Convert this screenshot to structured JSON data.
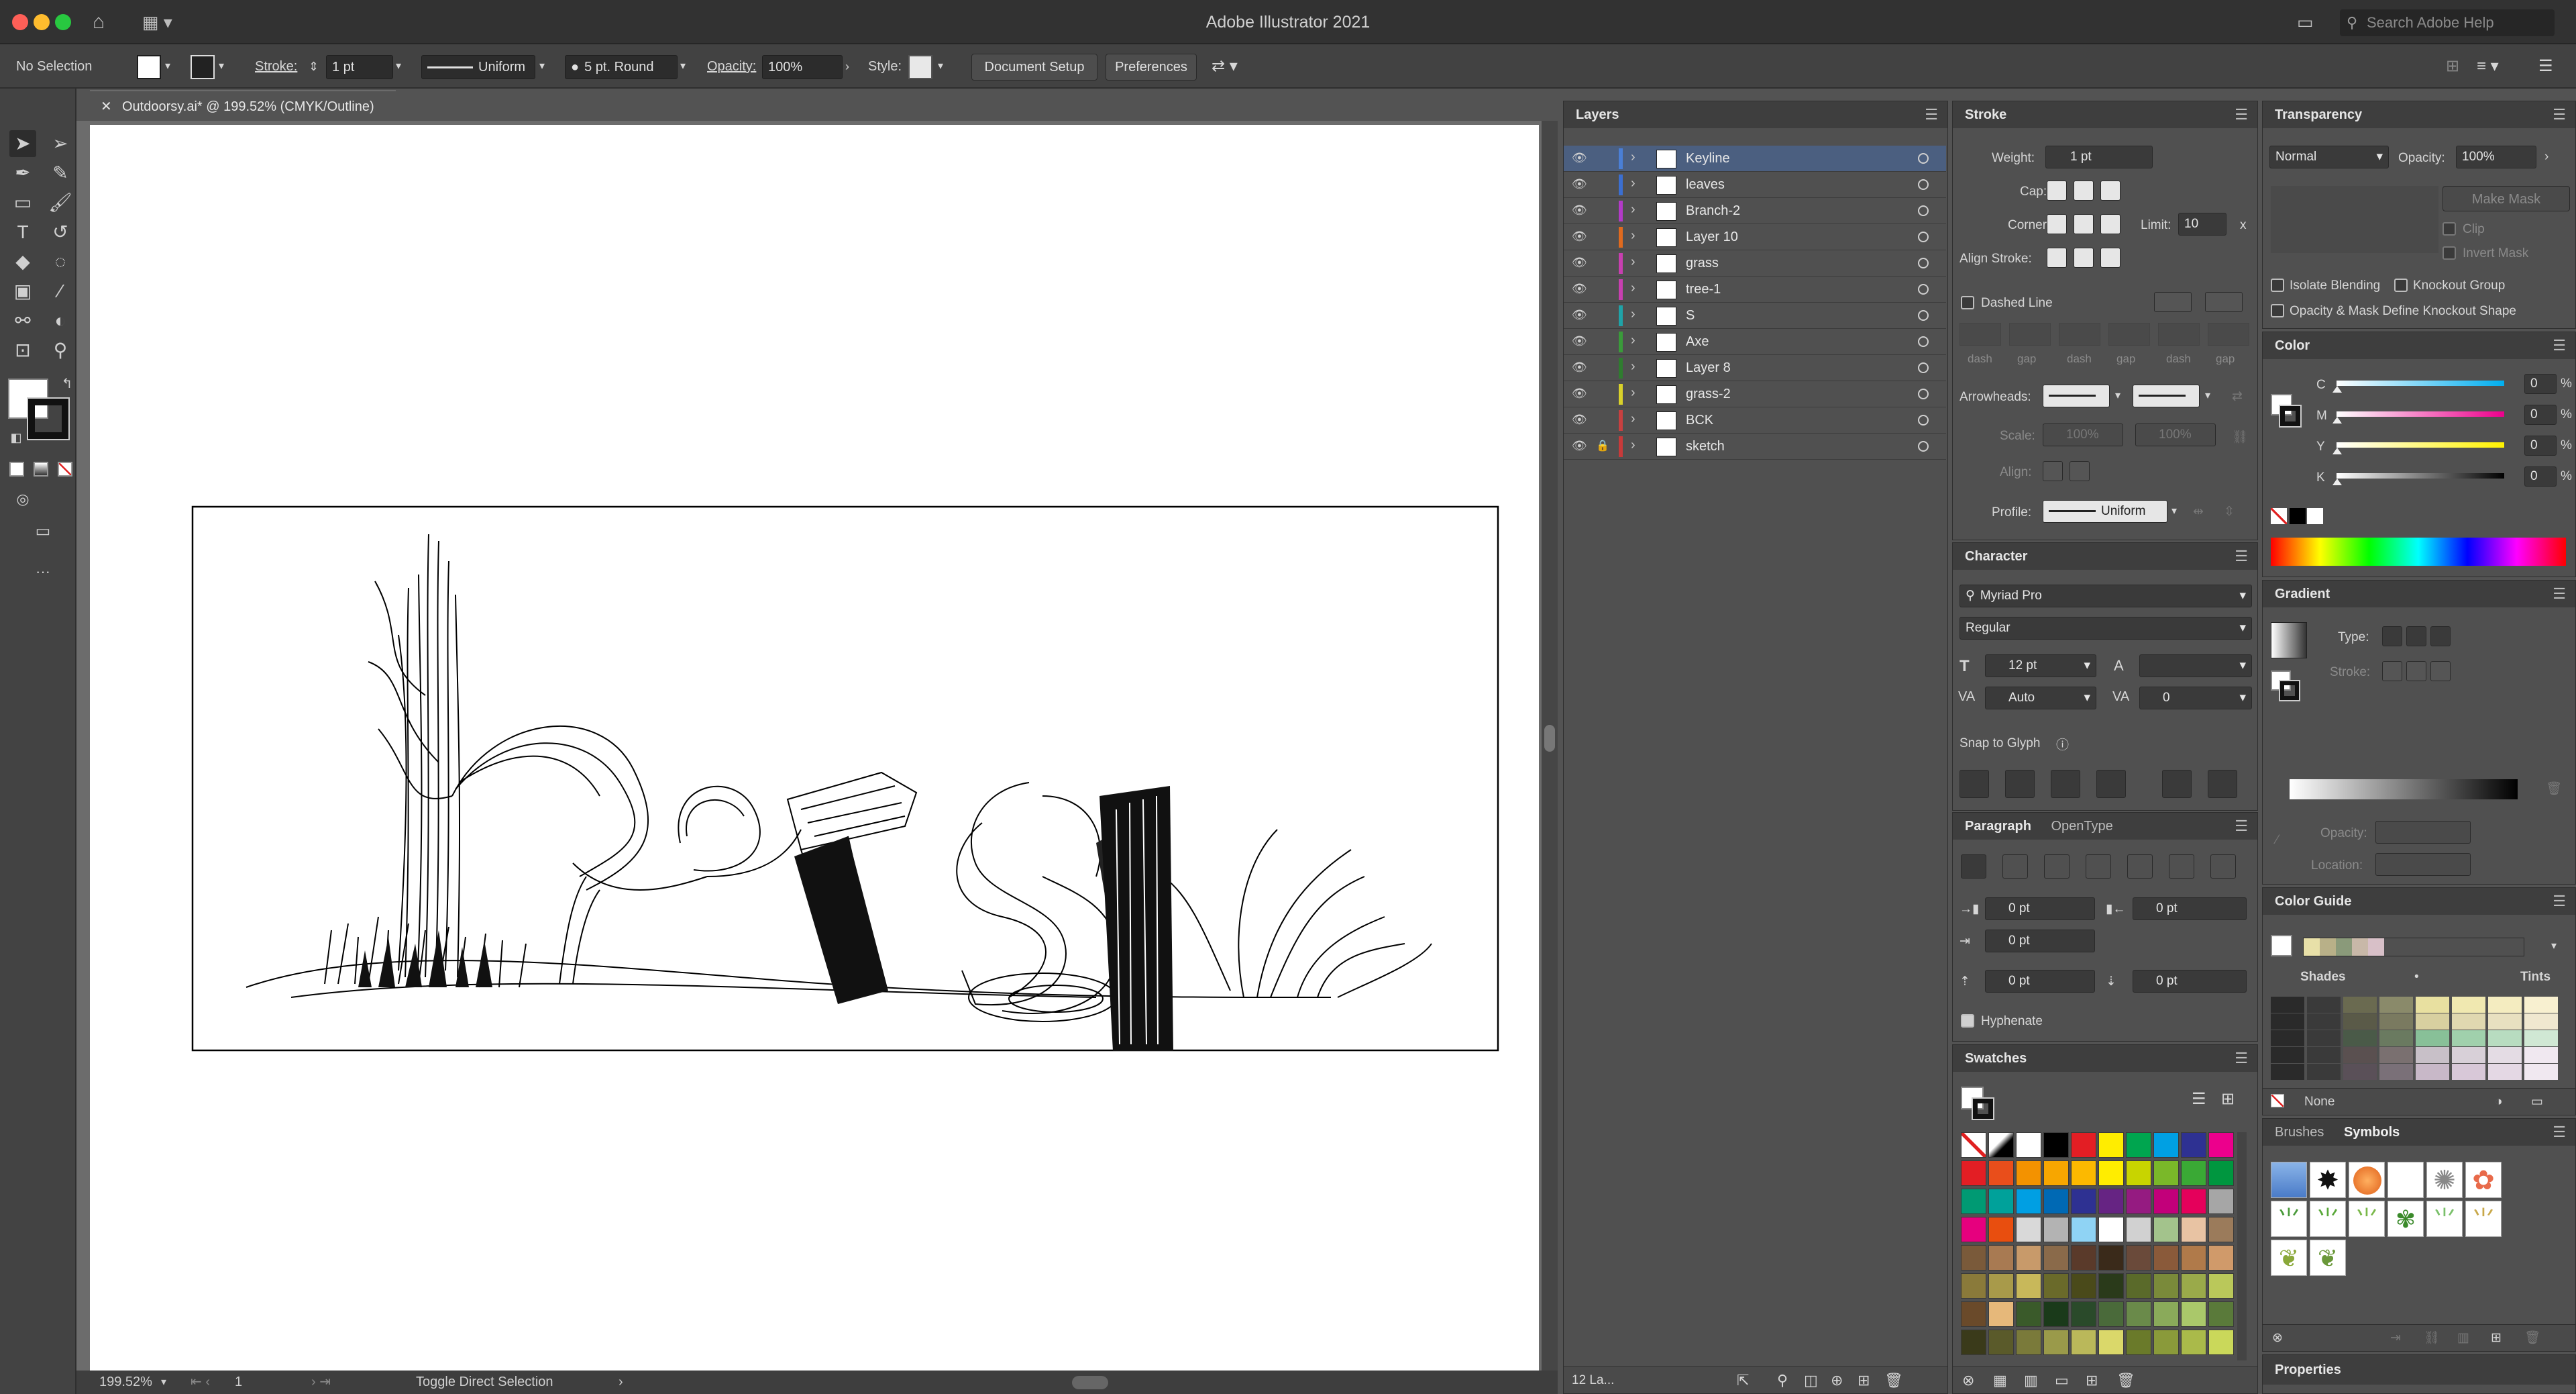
{
  "app": {
    "title": "Adobe Illustrator 2021",
    "search_placeholder": "Search Adobe Help"
  },
  "controlbar": {
    "selection": "No Selection",
    "stroke_label": "Stroke:",
    "stroke_weight": "1 pt",
    "profile": "Uniform",
    "brush": "5 pt. Round",
    "opacity_label": "Opacity:",
    "opacity": "100%",
    "style_label": "Style:",
    "document_setup": "Document Setup",
    "preferences": "Preferences"
  },
  "document": {
    "tab_title": "Outdoorsy.ai* @ 199.52% (CMYK/Outline)",
    "zoom": "199.52%",
    "artboard": "1",
    "status": "Toggle Direct Selection"
  },
  "layers": {
    "title": "Layers",
    "count": "12 La...",
    "items": [
      {
        "name": "Keyline",
        "color": "#4a7fd6",
        "selected": true
      },
      {
        "name": "leaves",
        "color": "#3b6fd1"
      },
      {
        "name": "Branch-2",
        "color": "#b33ac8"
      },
      {
        "name": "Layer 10",
        "color": "#e06a1e"
      },
      {
        "name": "grass",
        "color": "#c83fb0"
      },
      {
        "name": "tree-1",
        "color": "#c83fb0"
      },
      {
        "name": "S",
        "color": "#1fa3a8"
      },
      {
        "name": "Axe",
        "color": "#3a9b3a"
      },
      {
        "name": "Layer 8",
        "color": "#2f7d2f"
      },
      {
        "name": "grass-2",
        "color": "#d9d12a"
      },
      {
        "name": "BCK",
        "color": "#c84040"
      },
      {
        "name": "sketch",
        "color": "#c83a3a",
        "locked": true
      }
    ]
  },
  "stroke": {
    "title": "Stroke",
    "weight_label": "Weight:",
    "weight": "1 pt",
    "cap_label": "Cap:",
    "corner_label": "Corner:",
    "limit_label": "Limit:",
    "limit": "10",
    "limit_x": "x",
    "align_label": "Align Stroke:",
    "dashed_label": "Dashed Line",
    "dash_labels": [
      "dash",
      "gap",
      "dash",
      "gap",
      "dash",
      "gap"
    ],
    "arrowheads_label": "Arrowheads:",
    "scale_label": "Scale:",
    "scale_1": "100%",
    "scale_2": "100%",
    "align_arrow_label": "Align:",
    "profile_label": "Profile:",
    "profile": "Uniform"
  },
  "character": {
    "title": "Character",
    "font": "Myriad Pro",
    "style": "Regular",
    "size": "12 pt",
    "kerning": "Auto",
    "tracking": "0",
    "snap_label": "Snap to Glyph"
  },
  "paragraph": {
    "title": "Paragraph",
    "tab2": "OpenType",
    "left_indent": "0 pt",
    "right_indent": "0 pt",
    "first_indent": "0 pt",
    "space_before": "0 pt",
    "space_after": "0 pt",
    "hyphenate_label": "Hyphenate"
  },
  "swatches": {
    "title": "Swatches",
    "rows": [
      [
        "#ffffff",
        "#ffffff",
        "#ffffff",
        "#000000",
        "#e31e24",
        "#ffed00",
        "#00a54f",
        "#00a0e3",
        "#2e3192",
        "#ec008c"
      ],
      [
        "#e31e24",
        "#e94e1b",
        "#f39200",
        "#f7a600",
        "#fcb900",
        "#ffed00",
        "#c8d400",
        "#7ab829",
        "#3aa935",
        "#00963f"
      ],
      [
        "#009a73",
        "#00a19a",
        "#009fe3",
        "#0069b4",
        "#2e3192",
        "#662483",
        "#951b81",
        "#c2007a",
        "#e5005b",
        "#a6a6a6"
      ],
      [
        "#e6007e",
        "#e84e0f",
        "#d9d9d9",
        "#b3b3b3",
        "#8fd3f4",
        "#ffffff",
        "#d1d1d1",
        "#a3c38c",
        "#e8c3a3",
        "#9b7b5b"
      ],
      [
        "#7a5a3a",
        "#a87a52",
        "#c89a6a",
        "#8a6a4a",
        "#5a3a2a",
        "#3a2a1a",
        "#6a4a3a",
        "#8a5a3a",
        "#b07a4a",
        "#d09a6a"
      ],
      [
        "#8a7a3a",
        "#a89a4a",
        "#c8b85a",
        "#6a6a2a",
        "#4a4a1a",
        "#2a3a1a",
        "#5a6a2a",
        "#7a8a3a",
        "#9aaa4a",
        "#bac85a"
      ],
      [
        "#6a4a2a",
        "#e6b87a",
        "#3a5a2a",
        "#1a3a1a",
        "#2a4a2a",
        "#4a6a3a",
        "#6a8a4a",
        "#8aaa5a",
        "#aac86a",
        "#5a7a3a"
      ],
      [
        "#3a3a1a",
        "#5a5a2a",
        "#7a7a3a",
        "#9a9a4a",
        "#bab85a",
        "#dad86a",
        "#6a7a2a",
        "#8a9a3a",
        "#aaba4a",
        "#cad85a"
      ]
    ]
  },
  "transparency": {
    "title": "Transparency",
    "mode": "Normal",
    "opacity_label": "Opacity:",
    "opacity": "100%",
    "make_mask": "Make Mask",
    "clip": "Clip",
    "invert_mask": "Invert Mask",
    "isolate": "Isolate Blending",
    "knockout": "Knockout Group",
    "opacity_mask": "Opacity & Mask Define Knockout Shape"
  },
  "color": {
    "title": "Color",
    "channels": [
      {
        "label": "C",
        "value": "0",
        "unit": "%",
        "gradient": "linear-gradient(to right, #ffffff, #00aeef)"
      },
      {
        "label": "M",
        "value": "0",
        "unit": "%",
        "gradient": "linear-gradient(to right, #ffffff, #ec008c)"
      },
      {
        "label": "Y",
        "value": "0",
        "unit": "%",
        "gradient": "linear-gradient(to right, #ffffff, #fff200)"
      },
      {
        "label": "K",
        "value": "0",
        "unit": "%",
        "gradient": "linear-gradient(to right, #ffffff, #000000)"
      }
    ]
  },
  "gradient": {
    "title": "Gradient",
    "type_label": "Type:",
    "stroke_label": "Stroke:",
    "opacity_label": "Opacity:",
    "location_label": "Location:"
  },
  "color_guide": {
    "title": "Color Guide",
    "shades_label": "Shades",
    "tints_label": "Tints",
    "none_label": "None",
    "harmony": [
      "#e8e0a8",
      "#b8b088",
      "#8a9a7a",
      "#c8b8a8",
      "#d8c0c8"
    ],
    "grid": [
      [
        "#2a2a2a",
        "#3a3a3a",
        "#6a6a50",
        "#8a8a6a",
        "#e8e0a0",
        "#f0e8b0",
        "#f4ecc0",
        "#f8f0d0"
      ],
      [
        "#2a2a2a",
        "#3a3a3a",
        "#5a5a48",
        "#7a7a60",
        "#d8d0a0",
        "#e0d8b0",
        "#e8e0c0",
        "#f0e8d0"
      ],
      [
        "#2a2a2a",
        "#3a3a3a",
        "#4a5a48",
        "#6a7a60",
        "#88c098",
        "#a0d0ac",
        "#b8dcc0",
        "#d0e8d4"
      ],
      [
        "#2a2a2a",
        "#3a3a3a",
        "#5a5050",
        "#7a7070",
        "#c8c0c8",
        "#d8d0d8",
        "#e4dce4",
        "#f0e8f0"
      ],
      [
        "#2a2a2a",
        "#3a3a3a",
        "#5a5058",
        "#7a7078",
        "#c8b8c8",
        "#d8c8d8",
        "#e4d8e4",
        "#f0e8f0"
      ]
    ]
  },
  "brushes_symbols": {
    "tab1": "Brushes",
    "tab2": "Symbols"
  },
  "properties": {
    "title": "Properties"
  }
}
